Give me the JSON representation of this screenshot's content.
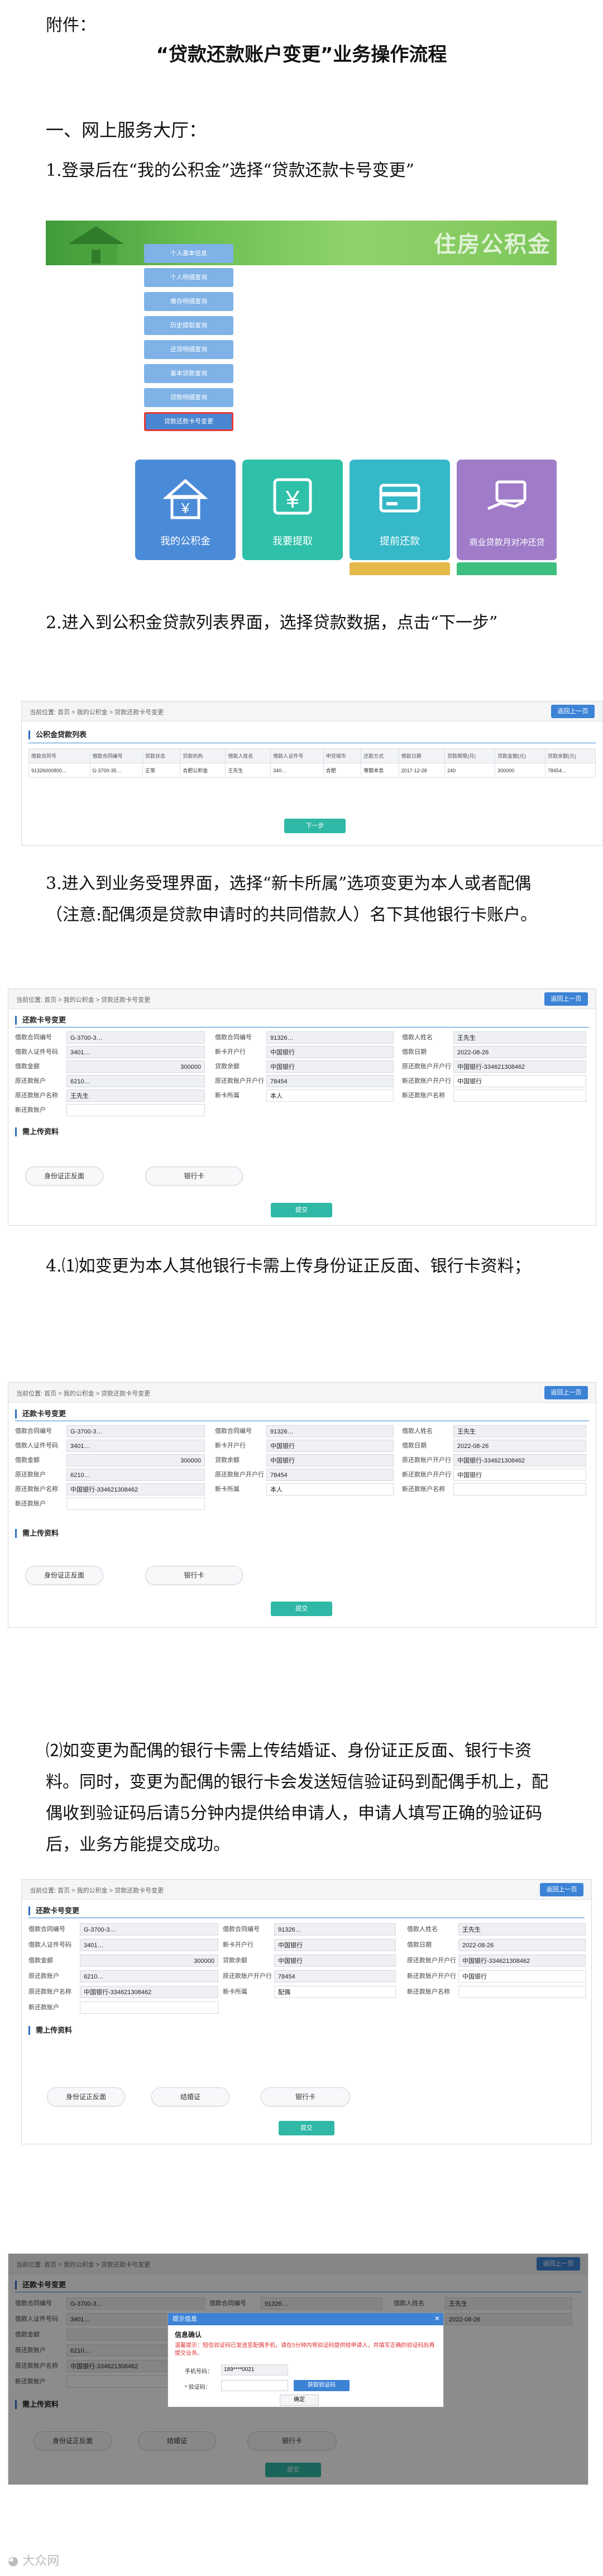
{
  "doc": {
    "attachment_label": "附件：",
    "title": "“贷款还款账户变更”业务操作流程",
    "section1": "一、网上服务大厅：",
    "step1": "1.登录后在“我的公积金”选择“贷款还款卡号变更”",
    "step2": "2.进入到公积金贷款列表界面，选择贷款数据，点击“下一步”",
    "step3": "3.进入到业务受理界面，选择“新卡所属”选项变更为本人或者配偶（注意:配偶须是贷款申请时的共同借款人）名下其他银行卡账户。",
    "step4a": "4.⑴如变更为本人其他银行卡需上传身份证正反面、银行卡资料；",
    "step4b": "⑵如变更为配偶的银行卡需上传结婚证、身份证正反面、银行卡资料。同时，变更为配偶的银行卡会发送短信验证码到配偶手机上，配偶收到验证码后请5分钟内提供给申请人，申请人填写正确的验证码后，业务方能提交成功。",
    "watermark": "大众网"
  },
  "shot1": {
    "banner_text": "住房公积金",
    "menu": [
      "个人基本信息",
      "个人明细查询",
      "缴存明细查询",
      "历史提取查询",
      "还贷明细查询",
      "基本贷款查询",
      "贷款明细查询",
      "贷款还款卡号变更"
    ],
    "tiles": [
      "我的公积金",
      "我要提取",
      "提前还款",
      "商业贷款月对冲还贷"
    ],
    "colors": {
      "tile1": "#4a8bd8",
      "tile2": "#2ec0a8",
      "tile3": "#35b8c8",
      "tile4": "#a07cc8"
    }
  },
  "common": {
    "crumb": "当前位置:  首页 > 我的公积金 > 贷款还款卡号变更",
    "back": "返回上一页",
    "next": "下一步",
    "submit": "提交",
    "section_change": "还款卡号变更",
    "section_upload": "需上传资料",
    "btn_idcard": "身份证正反面",
    "btn_bankcard": "银行卡",
    "btn_marriage": "结婚证"
  },
  "shot2": {
    "section": "公积金贷款列表",
    "headers": [
      "借款合同号",
      "借款合同编号",
      "贷款状态",
      "贷款机构",
      "借款人姓名",
      "借款人证件号",
      "申贷城市",
      "还款方式",
      "借款日期",
      "贷款期限(月)",
      "贷款金额(元)",
      "贷款余额(元)"
    ],
    "row": [
      "91326000800…",
      "G-3700-35…",
      "正常",
      "合肥公积金",
      "王先生",
      "340…",
      "合肥",
      "等额本息",
      "2017-12-28",
      "240",
      "300000",
      "78454…"
    ]
  },
  "form": {
    "labels": [
      "借款合同编号",
      "借款人证件号码",
      "借款金额",
      "原还款账户",
      "原还款账户名称",
      "新还款账户",
      "借款合同编号",
      "借款人姓名",
      "贷款余额",
      "新卡所属",
      "新卡开户行",
      "借款人姓名",
      "借款日期",
      "原还款账户开户行",
      "新还款账户开户行",
      "新还款账户名称"
    ],
    "values": {
      "contract": "G-3700-3…",
      "idno": "3401…",
      "amount": "300000",
      "old_acct": "6210…",
      "old_name": "王先生",
      "new_acct": "",
      "loan_id": "91326…",
      "name": "王先生",
      "balance": "78454",
      "owner_self": "本人",
      "owner_spouse": "配偶",
      "bank": "中国银行",
      "date": "2022-08-26",
      "old_bank": "中国银行",
      "new_bank": "中国银行",
      "new_name": "中国银行-334621308462"
    }
  },
  "modal": {
    "title": "提示信息",
    "heading": "信息确认",
    "message": "温馨提示：短信验证码已发送至配偶手机，请在5分钟内将验证码提供给申请人，并填写正确的验证码后再提交业务。",
    "phone_label": "手机号码：",
    "phone": "189****0021",
    "code_label": "* 验证码：",
    "send_btn": "获取验证码",
    "confirm": "确定"
  }
}
